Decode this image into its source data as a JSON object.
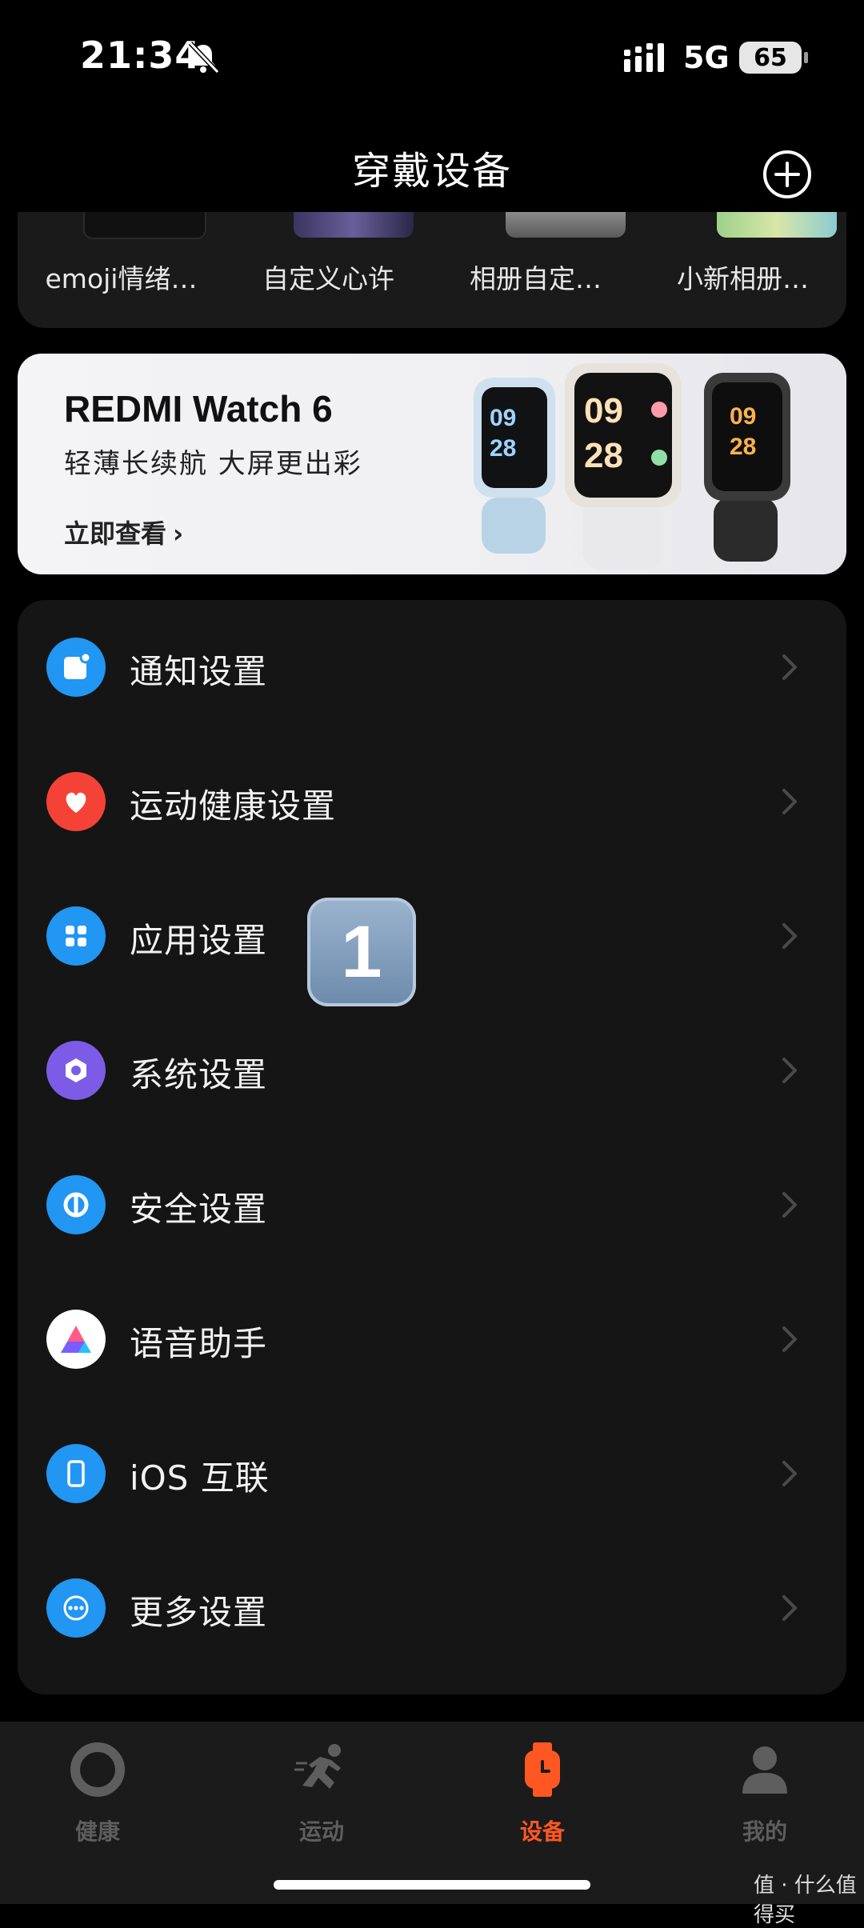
{
  "status_bar": {
    "time": "21:34",
    "network": "5G",
    "battery": "65"
  },
  "header": {
    "title": "穿戴设备"
  },
  "watch_faces": [
    {
      "label": "emoji情绪…"
    },
    {
      "label": "自定义心许"
    },
    {
      "label": "相册自定…"
    },
    {
      "label": "小新相册…"
    }
  ],
  "banner": {
    "title": "REDMI Watch 6",
    "subtitle": "轻薄长续航 大屏更出彩",
    "cta": "立即查看",
    "watch_time_hour": "09",
    "watch_time_minute": "28"
  },
  "menu": [
    {
      "label": "通知设置",
      "icon": "notification-icon",
      "color": "#2196f3"
    },
    {
      "label": "运动健康设置",
      "icon": "heart-icon",
      "color": "#f44336"
    },
    {
      "label": "应用设置",
      "icon": "apps-grid-icon",
      "color": "#2196f3"
    },
    {
      "label": "系统设置",
      "icon": "system-gear-icon",
      "color": "#7c5ce6"
    },
    {
      "label": "安全设置",
      "icon": "security-icon",
      "color": "#2196f3"
    },
    {
      "label": "语音助手",
      "icon": "voice-assistant-icon",
      "color": "#ffffff"
    },
    {
      "label": "iOS 互联",
      "icon": "phone-link-icon",
      "color": "#2196f3"
    },
    {
      "label": "更多设置",
      "icon": "more-icon",
      "color": "#2196f3"
    }
  ],
  "overlay_badge": "1",
  "tabs": [
    {
      "label": "健康",
      "active": false
    },
    {
      "label": "运动",
      "active": false
    },
    {
      "label": "设备",
      "active": true
    },
    {
      "label": "我的",
      "active": false
    }
  ],
  "colors": {
    "accent": "#ff5722",
    "card": "#151515",
    "background": "#000000"
  },
  "watermark": "值 · 什么值得买"
}
